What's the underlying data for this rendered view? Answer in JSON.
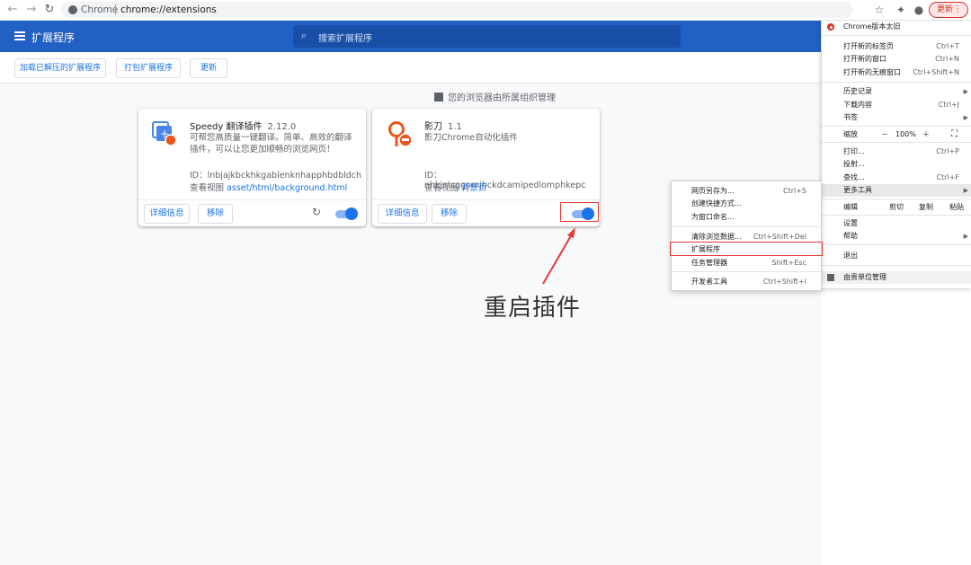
{
  "browser": {
    "origin_label": "Chrome",
    "url": "chrome://extensions",
    "update_label": "更新"
  },
  "header": {
    "title": "扩展程序",
    "search_placeholder": "搜索扩展程序"
  },
  "toolbar": {
    "load_unpacked": "加载已解压的扩展程序",
    "pack": "打包扩展程序",
    "update": "更新"
  },
  "managed_notice": "您的浏览器由所属组织管理",
  "extensions": [
    {
      "name": "Speedy 翻译插件",
      "version": "2.12.0",
      "description": "可帮您高质量一键翻译。简单、高效的翻译插件，可以让您更加顺畅的浏览网页！",
      "id": "ID：lnbjajkbckhkgablenknhapphbdbldch",
      "inspect_label": "查看视图",
      "inspect_link": "asset/html/background.html",
      "details": "详细信息",
      "remove": "移除",
      "enabled": true
    },
    {
      "name": "影刀",
      "version": "1.1",
      "description": "影刀Chrome自动化插件",
      "id": "ID：nhkjnlcggomjhckdcamipedlomphkepc",
      "inspect_label": "查看视图",
      "inspect_link": "背景页",
      "details": "详细信息",
      "remove": "移除",
      "enabled": true
    }
  ],
  "annotation": "重启插件",
  "menu": {
    "header": "Chrome版本太旧",
    "new_tab": "打开新的标签页",
    "new_tab_sc": "Ctrl+T",
    "new_window": "打开新的窗口",
    "new_window_sc": "Ctrl+N",
    "incognito": "打开新的无痕窗口",
    "incognito_sc": "Ctrl+Shift+N",
    "history": "历史记录",
    "downloads": "下载内容",
    "downloads_sc": "Ctrl+J",
    "bookmarks": "书签",
    "zoom": "缩放",
    "zoom_minus": "－",
    "zoom_value": "100%",
    "zoom_plus": "＋",
    "print": "打印...",
    "print_sc": "Ctrl+P",
    "cast": "投射...",
    "find": "查找...",
    "find_sc": "Ctrl+F",
    "more_tools": "更多工具",
    "edit": "编辑",
    "cut": "剪切",
    "copy": "复制",
    "paste": "粘贴",
    "settings": "设置",
    "help": "帮助",
    "exit": "退出",
    "managed": "由贵单位管理"
  },
  "submenu": {
    "save_page": "网页另存为...",
    "save_page_sc": "Ctrl+S",
    "create_shortcut": "创建快捷方式...",
    "name_window": "为窗口命名...",
    "clear_data": "清除浏览数据...",
    "clear_data_sc": "Ctrl+Shift+Del",
    "extensions": "扩展程序",
    "task_manager": "任务管理器",
    "task_manager_sc": "Shift+Esc",
    "dev_tools": "开发者工具",
    "dev_tools_sc": "Ctrl+Shift+I"
  }
}
